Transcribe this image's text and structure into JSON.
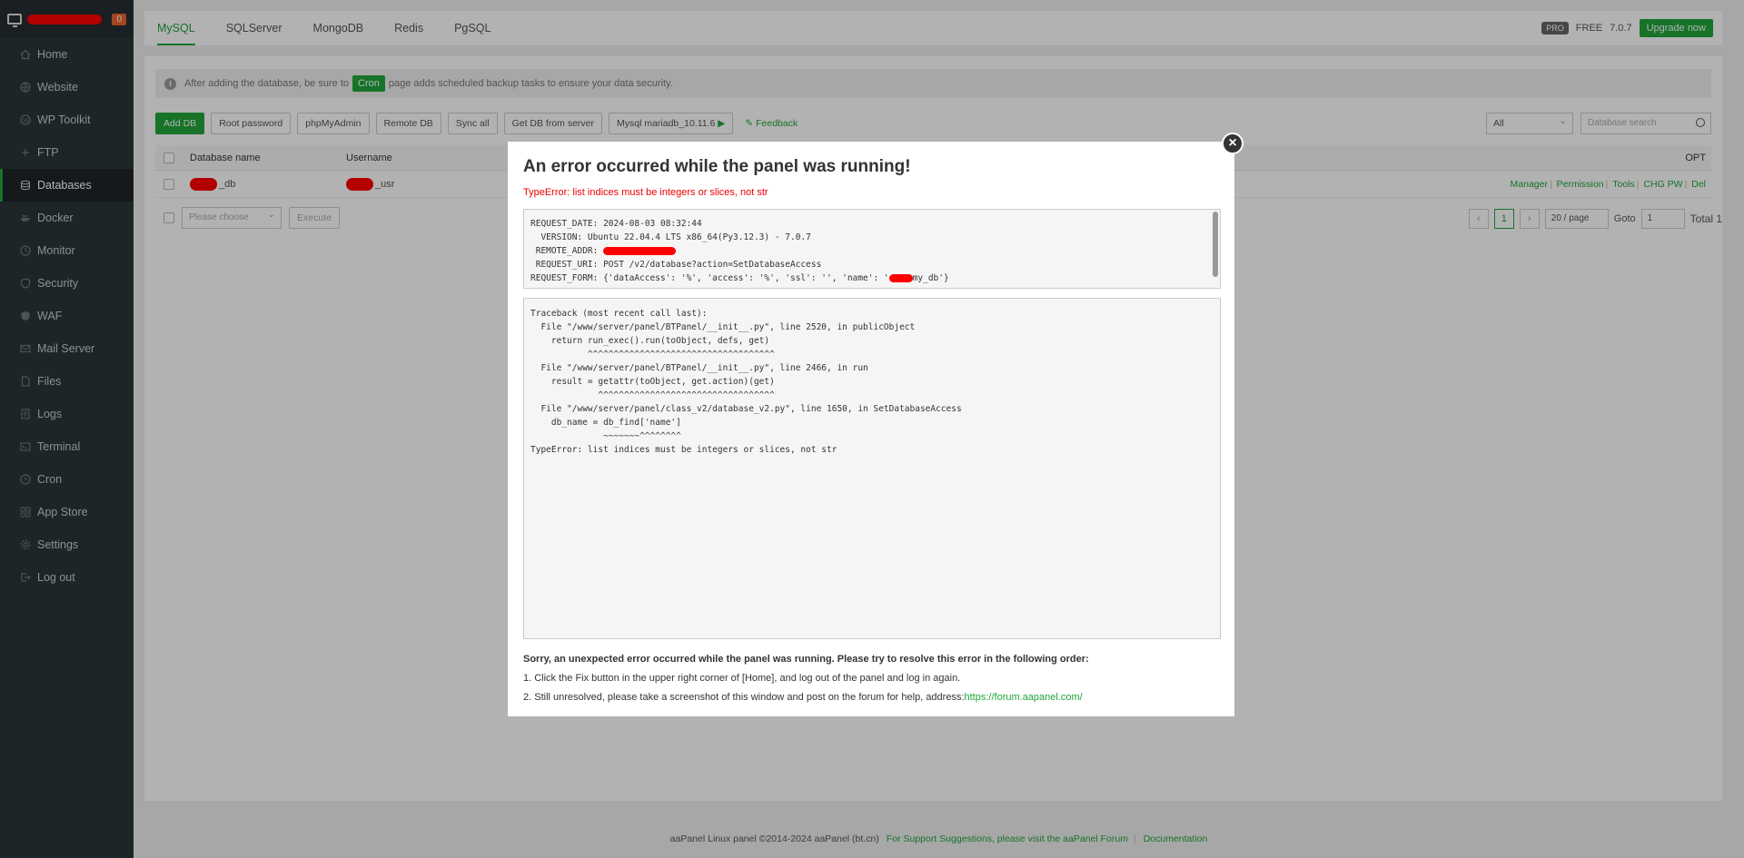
{
  "sidebar": {
    "badge": "0",
    "items": [
      {
        "label": "Home",
        "icon": "home-icon"
      },
      {
        "label": "Website",
        "icon": "globe-icon"
      },
      {
        "label": "WP Toolkit",
        "icon": "wordpress-icon"
      },
      {
        "label": "FTP",
        "icon": "ftp-icon"
      },
      {
        "label": "Databases",
        "icon": "database-icon"
      },
      {
        "label": "Docker",
        "icon": "docker-icon"
      },
      {
        "label": "Monitor",
        "icon": "monitor-icon"
      },
      {
        "label": "Security",
        "icon": "shield-icon"
      },
      {
        "label": "WAF",
        "icon": "waf-icon"
      },
      {
        "label": "Mail Server",
        "icon": "mail-icon"
      },
      {
        "label": "Files",
        "icon": "file-icon"
      },
      {
        "label": "Logs",
        "icon": "logs-icon"
      },
      {
        "label": "Terminal",
        "icon": "terminal-icon"
      },
      {
        "label": "Cron",
        "icon": "clock-icon"
      },
      {
        "label": "App Store",
        "icon": "grid-icon"
      },
      {
        "label": "Settings",
        "icon": "gear-icon"
      },
      {
        "label": "Log out",
        "icon": "logout-icon"
      }
    ],
    "active_index": 4
  },
  "tabs": [
    "MySQL",
    "SQLServer",
    "MongoDB",
    "Redis",
    "PgSQL"
  ],
  "header_right": {
    "pro": "PRO",
    "free": "FREE",
    "version": "7.0.7",
    "upgrade": "Upgrade now"
  },
  "notice": {
    "before": "After adding the database, be sure to",
    "chip": "Cron",
    "after": "page adds scheduled backup tasks to ensure your data security."
  },
  "toolbar": {
    "buttons": [
      "Add DB",
      "Root password",
      "phpMyAdmin",
      "Remote DB",
      "Sync all",
      "Get DB from server"
    ],
    "mysql_version": "Mysql mariadb_10.11.6",
    "feedback": "Feedback",
    "filter": "All",
    "search_placeholder": "Database search"
  },
  "table": {
    "headers": {
      "name": "Database name",
      "user": "Username",
      "opt": "OPT"
    },
    "row": {
      "name_suffix": "_db",
      "user_suffix": "_usr",
      "actions": [
        "Manager",
        "Permission",
        "Tools",
        "CHG PW",
        "Del"
      ]
    }
  },
  "bottom": {
    "choose_placeholder": "Please choose",
    "execute": "Execute"
  },
  "pagination": {
    "current": "1",
    "page_size": "20 / page",
    "goto_label": "Goto",
    "goto_value": "1",
    "total": "Total 1"
  },
  "footer": {
    "copyright": "aaPanel Linux panel ©2014-2024 aaPanel (bt.cn)",
    "support": "For Support Suggestions, please visit the aaPanel Forum",
    "docs": "Documentation"
  },
  "modal": {
    "title": "An error occurred while the panel was running!",
    "subtitle": "TypeError: list indices must be integers or slices, not str",
    "request": {
      "date": "REQUEST_DATE: 2024-08-03 08:32:44",
      "version": "  VERSION: Ubuntu 22.04.4 LTS x86_64(Py3.12.3) - 7.0.7",
      "remote": " REMOTE_ADDR: ",
      "uri": " REQUEST_URI: POST /v2/database?action=SetDatabaseAccess",
      "form_before": "REQUEST_FORM: {'dataAccess': '%', 'access': '%', 'ssl': '', 'name': '",
      "form_after": "my_db'}"
    },
    "traceback": "Traceback (most recent call last):\n  File \"/www/server/panel/BTPanel/__init__.py\", line 2520, in publicObject\n    return run_exec().run(toObject, defs, get)\n           ^^^^^^^^^^^^^^^^^^^^^^^^^^^^^^^^^^^^\n  File \"/www/server/panel/BTPanel/__init__.py\", line 2466, in run\n    result = getattr(toObject, get.action)(get)\n             ^^^^^^^^^^^^^^^^^^^^^^^^^^^^^^^^^^\n  File \"/www/server/panel/class_v2/database_v2.py\", line 1650, in SetDatabaseAccess\n    db_name = db_find['name']\n              ~~~~~~~^^^^^^^^\nTypeError: list indices must be integers or slices, not str",
    "help_title": "Sorry, an unexpected error occurred while the panel was running. Please try to resolve this error in the following order:",
    "step1": "1. Click the Fix button in the upper right corner of [Home], and log out of the panel and log in again.",
    "step2_text": "2. Still unresolved, please take a screenshot of this window and post on the forum for help, address:",
    "step2_link": "https://forum.aapanel.com/"
  }
}
